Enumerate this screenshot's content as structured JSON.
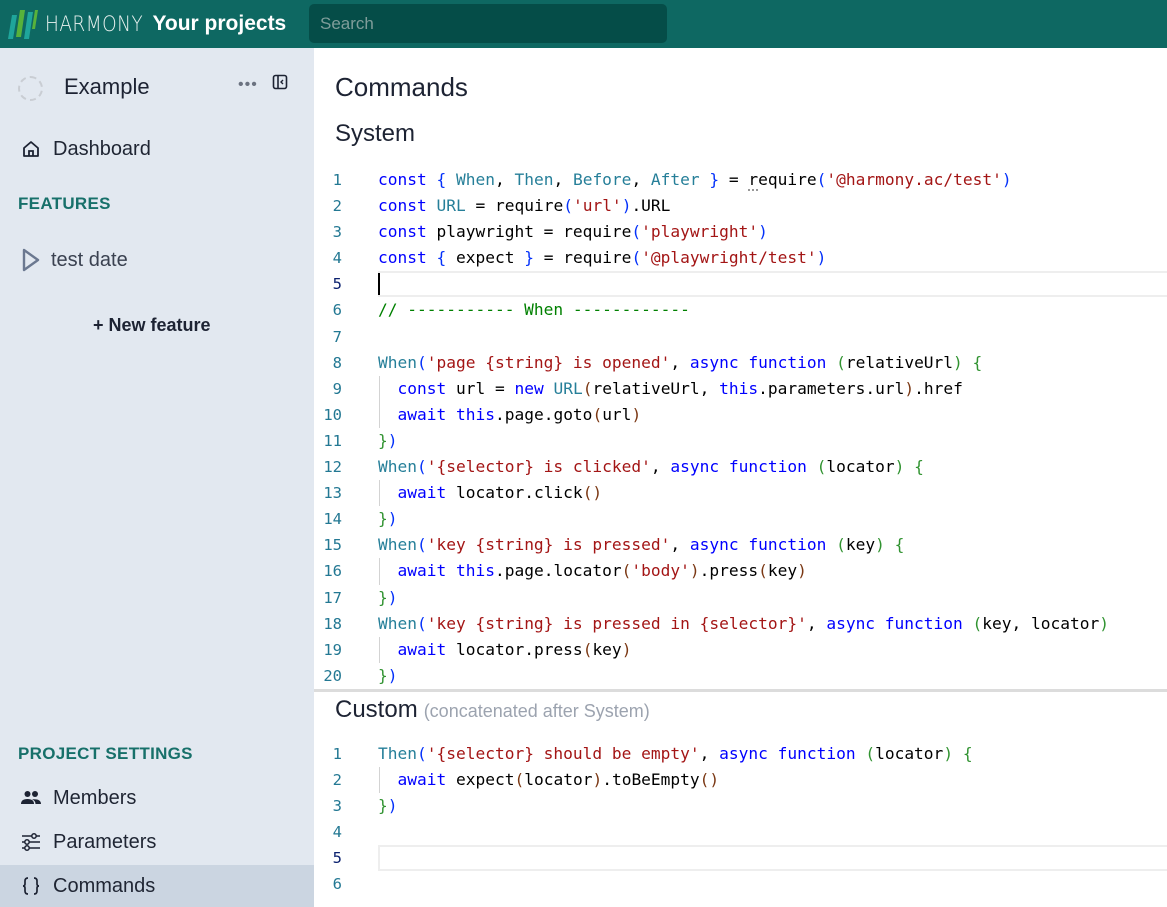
{
  "topbar": {
    "logo_text": "HARMONY",
    "projects_link": "Your projects",
    "search_placeholder": "Search",
    "search_value": "",
    "colors": {
      "background": "#0e6862",
      "search_bg": "#054d48"
    }
  },
  "sidebar": {
    "project_name": "Example",
    "more_label": "•••",
    "dashboard_label": "Dashboard",
    "features_title": "FEATURES",
    "features": [
      {
        "label": "test date",
        "icon": "play-outline-icon"
      }
    ],
    "new_feature_label": "+ New feature",
    "settings_title": "PROJECT SETTINGS",
    "settings_items": [
      {
        "label": "Members",
        "icon": "people-icon",
        "active": false
      },
      {
        "label": "Parameters",
        "icon": "sliders-icon",
        "active": false
      },
      {
        "label": "Commands",
        "icon": "braces-icon",
        "active": true
      }
    ],
    "colors": {
      "background": "#e2e8f0",
      "active_bg": "#cbd5e1",
      "section_title": "#17706a"
    }
  },
  "main": {
    "page_title": "Commands",
    "system": {
      "title": "System",
      "lines": [
        [
          [
            "kw",
            "const"
          ],
          [
            "br1",
            " { "
          ],
          [
            "fn",
            "When"
          ],
          [
            "",
            ","
          ],
          [
            "fn",
            " Then"
          ],
          [
            "",
            ","
          ],
          [
            "fn",
            " Before"
          ],
          [
            "",
            ","
          ],
          [
            "fn",
            " After"
          ],
          [
            "br1",
            " }"
          ],
          [
            "",
            " = "
          ],
          [
            "squig",
            "r"
          ],
          [
            "",
            "equire"
          ],
          [
            "br1",
            "("
          ],
          [
            "str",
            "'@harmony.ac/test'"
          ],
          [
            "br1",
            ")"
          ]
        ],
        [
          [
            "kw",
            "const"
          ],
          [
            "",
            " "
          ],
          [
            "fn",
            "URL"
          ],
          [
            "",
            " = require"
          ],
          [
            "br1",
            "("
          ],
          [
            "str",
            "'url'"
          ],
          [
            "br1",
            ")"
          ],
          [
            "",
            ".URL"
          ]
        ],
        [
          [
            "kw",
            "const"
          ],
          [
            "",
            " playwright = require"
          ],
          [
            "br1",
            "("
          ],
          [
            "str",
            "'playwright'"
          ],
          [
            "br1",
            ")"
          ]
        ],
        [
          [
            "kw",
            "const"
          ],
          [
            "br1",
            " { "
          ],
          [
            "",
            "expect"
          ],
          [
            "br1",
            " }"
          ],
          [
            "",
            " = require"
          ],
          [
            "br1",
            "("
          ],
          [
            "str",
            "'@playwright/test'"
          ],
          [
            "br1",
            ")"
          ]
        ],
        [],
        [
          [
            "cm",
            "// ----------- When ------------"
          ]
        ],
        [],
        [
          [
            "fn",
            "When"
          ],
          [
            "br1",
            "("
          ],
          [
            "str",
            "'page {string} is opened'"
          ],
          [
            "",
            ", "
          ],
          [
            "kw",
            "async function"
          ],
          [
            "",
            " "
          ],
          [
            "br2",
            "("
          ],
          [
            "",
            "relativeUrl"
          ],
          [
            "br2",
            ")"
          ],
          [
            "",
            " "
          ],
          [
            "br2",
            "{"
          ]
        ],
        [
          [
            "",
            "  "
          ],
          [
            "kw",
            "const"
          ],
          [
            "",
            " url = "
          ],
          [
            "kw",
            "new"
          ],
          [
            "",
            " "
          ],
          [
            "fn",
            "URL"
          ],
          [
            "br3",
            "("
          ],
          [
            "",
            "relativeUrl, "
          ],
          [
            "kw",
            "this"
          ],
          [
            "",
            ".parameters.url"
          ],
          [
            "br3",
            ")"
          ],
          [
            "",
            ".href"
          ]
        ],
        [
          [
            "",
            "  "
          ],
          [
            "kw",
            "await"
          ],
          [
            "",
            " "
          ],
          [
            "kw",
            "this"
          ],
          [
            "",
            ".page.goto"
          ],
          [
            "br3",
            "("
          ],
          [
            "",
            "url"
          ],
          [
            "br3",
            ")"
          ]
        ],
        [
          [
            "br2",
            "}"
          ],
          [
            "br1",
            ")"
          ]
        ],
        [
          [
            "fn",
            "When"
          ],
          [
            "br1",
            "("
          ],
          [
            "str",
            "'{selector} is clicked'"
          ],
          [
            "",
            ", "
          ],
          [
            "kw",
            "async function"
          ],
          [
            "",
            " "
          ],
          [
            "br2",
            "("
          ],
          [
            "",
            "locator"
          ],
          [
            "br2",
            ")"
          ],
          [
            "",
            " "
          ],
          [
            "br2",
            "{"
          ]
        ],
        [
          [
            "",
            "  "
          ],
          [
            "kw",
            "await"
          ],
          [
            "",
            " locator.click"
          ],
          [
            "br3",
            "()"
          ]
        ],
        [
          [
            "br2",
            "}"
          ],
          [
            "br1",
            ")"
          ]
        ],
        [
          [
            "fn",
            "When"
          ],
          [
            "br1",
            "("
          ],
          [
            "str",
            "'key {string} is pressed'"
          ],
          [
            "",
            ", "
          ],
          [
            "kw",
            "async function"
          ],
          [
            "",
            " "
          ],
          [
            "br2",
            "("
          ],
          [
            "",
            "key"
          ],
          [
            "br2",
            ")"
          ],
          [
            "",
            " "
          ],
          [
            "br2",
            "{"
          ]
        ],
        [
          [
            "",
            "  "
          ],
          [
            "kw",
            "await"
          ],
          [
            "",
            " "
          ],
          [
            "kw",
            "this"
          ],
          [
            "",
            ".page.locator"
          ],
          [
            "br3",
            "("
          ],
          [
            "str",
            "'body'"
          ],
          [
            "br3",
            ")"
          ],
          [
            "",
            ".press"
          ],
          [
            "br3",
            "("
          ],
          [
            "",
            "key"
          ],
          [
            "br3",
            ")"
          ]
        ],
        [
          [
            "br2",
            "}"
          ],
          [
            "br1",
            ")"
          ]
        ],
        [
          [
            "fn",
            "When"
          ],
          [
            "br1",
            "("
          ],
          [
            "str",
            "'key {string} is pressed in {selector}'"
          ],
          [
            "",
            ", "
          ],
          [
            "kw",
            "async function"
          ],
          [
            "",
            " "
          ],
          [
            "br2",
            "("
          ],
          [
            "",
            "key, locator"
          ],
          [
            "br2",
            ")"
          ]
        ],
        [
          [
            "",
            "  "
          ],
          [
            "kw",
            "await"
          ],
          [
            "",
            " locator.press"
          ],
          [
            "br3",
            "("
          ],
          [
            "",
            "key"
          ],
          [
            "br3",
            ")"
          ]
        ],
        [
          [
            "br2",
            "}"
          ],
          [
            "br1",
            ")"
          ]
        ]
      ],
      "guide_lines": [
        9,
        10,
        13,
        16,
        19
      ],
      "current_line": 5
    },
    "custom": {
      "title": "Custom",
      "subtitle": "(concatenated after System)",
      "lines": [
        [
          [
            "fn",
            "Then"
          ],
          [
            "br1",
            "("
          ],
          [
            "str",
            "'{selector} should be empty'"
          ],
          [
            "",
            ", "
          ],
          [
            "kw",
            "async function"
          ],
          [
            "",
            " "
          ],
          [
            "br2",
            "("
          ],
          [
            "",
            "locator"
          ],
          [
            "br2",
            ")"
          ],
          [
            "",
            " "
          ],
          [
            "br2",
            "{"
          ]
        ],
        [
          [
            "",
            "  "
          ],
          [
            "kw",
            "await"
          ],
          [
            "",
            " expect"
          ],
          [
            "br3",
            "("
          ],
          [
            "",
            "locator"
          ],
          [
            "br3",
            ")"
          ],
          [
            "",
            ".toBeEmpty"
          ],
          [
            "br3",
            "()"
          ]
        ],
        [
          [
            "br2",
            "}"
          ],
          [
            "br1",
            ")"
          ]
        ],
        [],
        [],
        []
      ],
      "guide_lines": [
        2
      ],
      "current_line": 5
    }
  }
}
